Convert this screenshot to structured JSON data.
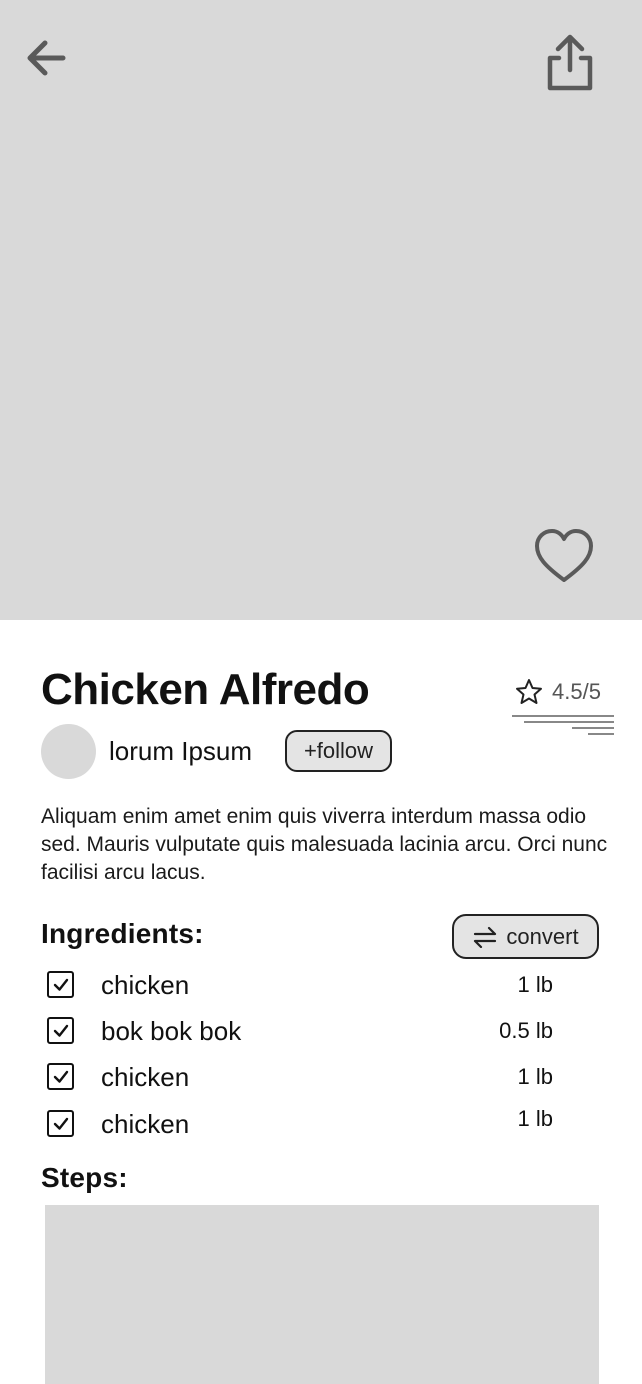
{
  "icons": {
    "back": "arrow-left-icon",
    "share": "share-icon",
    "favorite": "heart-icon",
    "rating": "star-icon",
    "checkbox": "checkbox-checked-icon",
    "convert": "swap-arrows-icon"
  },
  "recipe": {
    "title": "Chicken Alfredo",
    "rating": "4.5/5",
    "rating_value": 4.5,
    "rating_max": 5,
    "author": "lorum Ipsum",
    "follow_label": "+follow",
    "description": "Aliquam enim amet enim quis viverra interdum massa odio sed. Mauris vulputate quis malesuada lacinia arcu. Orci nunc facilisi arcu lacus."
  },
  "ingredients": {
    "title": "Ingredients:",
    "convert_label": "convert",
    "items": [
      {
        "name": "chicken",
        "qty": "1 lb",
        "checked": true
      },
      {
        "name": "bok bok bok",
        "qty": "0.5 lb",
        "checked": true
      },
      {
        "name": "chicken",
        "qty": "1 lb",
        "checked": true
      },
      {
        "name": "chicken",
        "qty": "1 lb",
        "checked": true
      }
    ]
  },
  "steps": {
    "title": "Steps:"
  },
  "colors": {
    "placeholder": "#d9d9d9",
    "button_fill": "#e4e4e4",
    "text": "#111111",
    "muted": "#555555"
  }
}
